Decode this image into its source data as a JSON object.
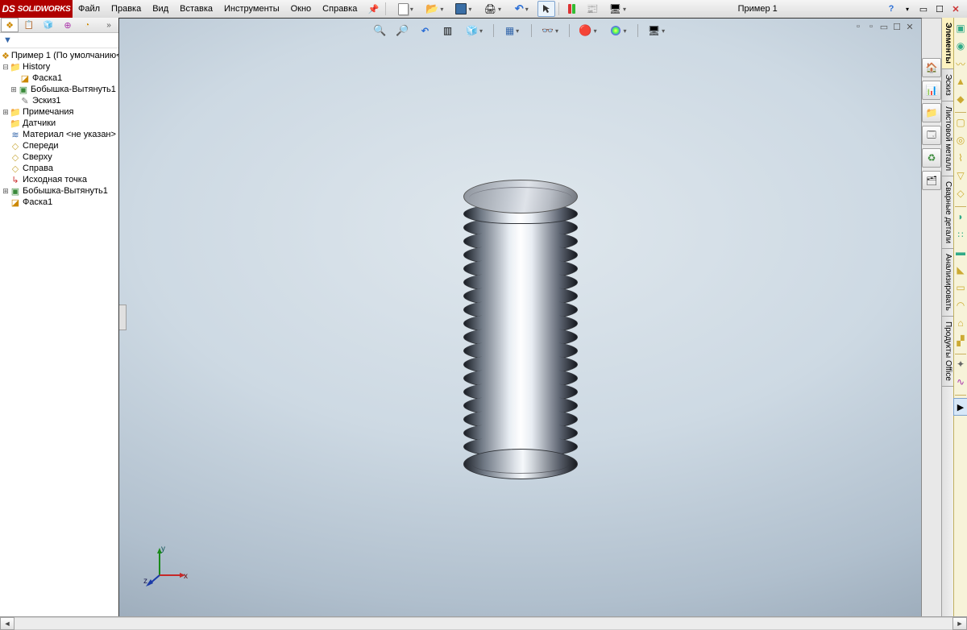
{
  "app": {
    "brand_prefix": "DS",
    "brand": "SOLIDWORKS",
    "document_title": "Пример 1"
  },
  "menu": {
    "file": "Файл",
    "edit": "Правка",
    "view": "Вид",
    "insert": "Вставка",
    "tools": "Инструменты",
    "window": "Окно",
    "help": "Справка"
  },
  "tree": {
    "root": "Пример 1  (По умолчанию<",
    "history": "History",
    "chamfer1": "Фаска1",
    "extrude1": "Бобышка-Вытянуть1",
    "sketch1": "Эскиз1",
    "annotations": "Примечания",
    "sensors": "Датчики",
    "material": "Материал <не указан>",
    "front": "Спереди",
    "top": "Сверху",
    "right": "Справа",
    "origin": "Исходная точка",
    "extrude1_b": "Бобышка-Вытянуть1",
    "chamfer1_b": "Фаска1"
  },
  "right_tabs": {
    "elements": "Элементы",
    "sketch": "Эскиз",
    "sheetmetal": "Листовой металл",
    "weldments": "Сварные детали",
    "analyze": "Анализировать",
    "office": "Продукты Office"
  },
  "triad": {
    "x": "x",
    "y": "y",
    "z": "z"
  }
}
